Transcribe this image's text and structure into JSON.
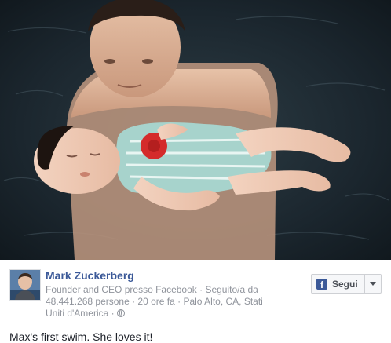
{
  "post": {
    "author_name": "Mark Zuckerberg",
    "author_details": "Founder and CEO presso Facebook · Seguito/a da 48.441.268 persone · 20 ore fa · Palo Alto, CA, Stati Uniti d'America · ",
    "privacy_icon": "globe-icon",
    "message": "Max's first swim. She loves it!"
  },
  "follow": {
    "label": "Segui",
    "icon": "facebook-icon",
    "icon_glyph": "f",
    "dropdown_icon": "caret-down-icon"
  },
  "photo": {
    "subject": "father-holding-baby-in-pool"
  },
  "colors": {
    "link_blue": "#3b5998",
    "meta_gray": "#90949c",
    "text": "#1d2129"
  }
}
